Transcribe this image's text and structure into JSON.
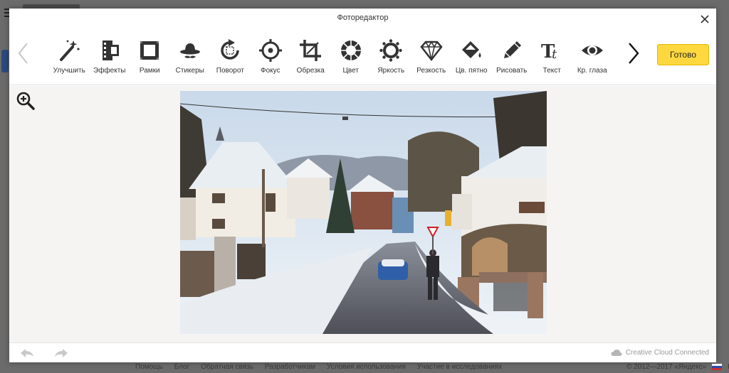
{
  "modal": {
    "title": "Фоторедактор",
    "done_label": "Готово"
  },
  "toolbar": {
    "tools": [
      {
        "label": "Улучшить",
        "icon": "magic-wand-icon"
      },
      {
        "label": "Эффекты",
        "icon": "film-effects-icon"
      },
      {
        "label": "Рамки",
        "icon": "frame-icon"
      },
      {
        "label": "Стикеры",
        "icon": "sticker-hat-icon"
      },
      {
        "label": "Поворот",
        "icon": "rotate-icon"
      },
      {
        "label": "Фокус",
        "icon": "focus-icon"
      },
      {
        "label": "Обрезка",
        "icon": "crop-icon"
      },
      {
        "label": "Цвет",
        "icon": "color-icon"
      },
      {
        "label": "Яркость",
        "icon": "brightness-icon"
      },
      {
        "label": "Резкость",
        "icon": "sharpness-diamond-icon"
      },
      {
        "label": "Цв. пятно",
        "icon": "color-splash-icon"
      },
      {
        "label": "Рисовать",
        "icon": "pencil-icon"
      },
      {
        "label": "Текст",
        "icon": "text-icon"
      },
      {
        "label": "Кр. глаза",
        "icon": "red-eye-icon"
      }
    ]
  },
  "status": {
    "creative_cloud": "Creative Cloud Connected"
  },
  "background_page": {
    "footer_links": [
      "Помощь",
      "Блог",
      "Обратная связь",
      "Разработчикам",
      "Условия использования",
      "Участие в исследованиях"
    ],
    "copyright": "© 2012—2017 «Яндекс»",
    "language": "RU"
  },
  "colors": {
    "done_button": "#ffd840",
    "canvas_bg": "#f5f4f3",
    "icon": "#333333"
  }
}
